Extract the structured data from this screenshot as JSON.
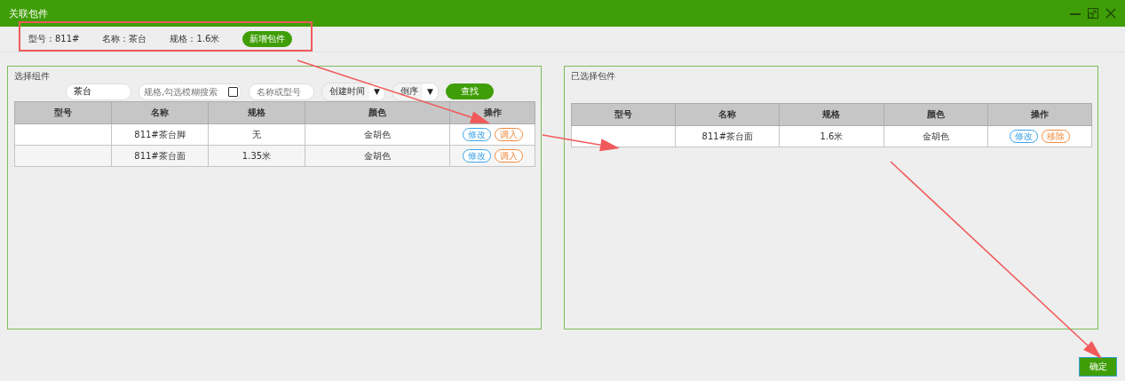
{
  "window": {
    "title": "关联包件"
  },
  "info": {
    "fields": [
      {
        "label": "型号：",
        "value": "811#"
      },
      {
        "label": "名称：",
        "value": "茶台"
      },
      {
        "label": "规格：",
        "value": "1.6米"
      }
    ],
    "add_button": "新增包件"
  },
  "left_panel": {
    "title": "选择组件",
    "filters": [
      {
        "kind": "input",
        "value": "茶台"
      },
      {
        "kind": "checkbox-input",
        "placeholder": "规格,勾选模糊搜索",
        "checked": false
      },
      {
        "kind": "input",
        "placeholder": "名称或型号"
      },
      {
        "kind": "select",
        "value": "创建时间",
        "caret": "▼"
      },
      {
        "kind": "select",
        "value": "倒序",
        "caret": "▼"
      }
    ],
    "search_button": "查找",
    "table": {
      "columns": [
        "型号",
        "名称",
        "规格",
        "颜色",
        "操作"
      ],
      "rows": [
        {
          "cells": [
            "",
            "811#茶台脚",
            "无",
            "金胡色"
          ],
          "actions": [
            {
              "kind": "edit",
              "label": "修改"
            },
            {
              "kind": "add",
              "label": "调入"
            }
          ]
        },
        {
          "cells": [
            "",
            "811#茶台面",
            "1.35米",
            "金胡色"
          ],
          "actions": [
            {
              "kind": "edit",
              "label": "修改"
            },
            {
              "kind": "add",
              "label": "调入"
            }
          ]
        }
      ]
    }
  },
  "right_panel": {
    "title": "已选择包件",
    "table": {
      "columns": [
        "型号",
        "名称",
        "规格",
        "颜色",
        "操作"
      ],
      "rows": [
        {
          "cells": [
            "",
            "811#茶台面",
            "1.6米",
            "金胡色"
          ],
          "actions": [
            {
              "kind": "edit",
              "label": "修改"
            },
            {
              "kind": "remove",
              "label": "移除"
            }
          ]
        }
      ]
    }
  },
  "confirm_button": "确定"
}
